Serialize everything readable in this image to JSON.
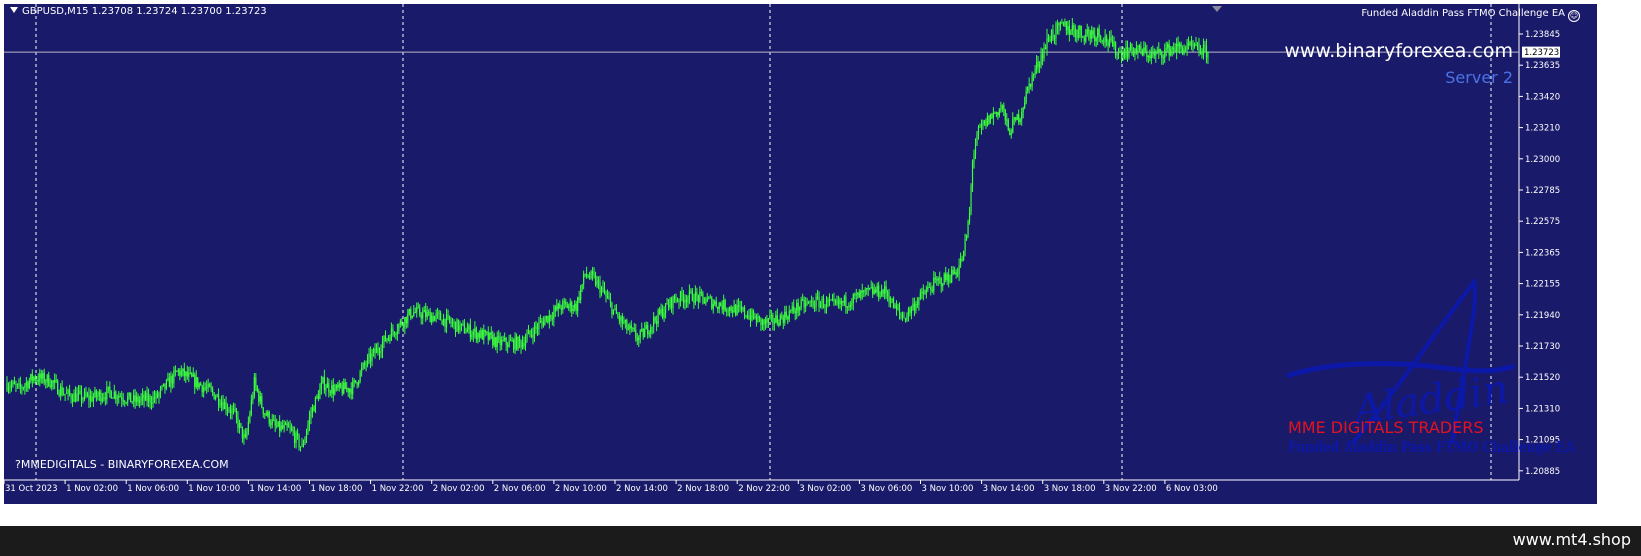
{
  "header": {
    "symbol_line": "GBPUSD,M15  1.23708 1.23724 1.23700 1.23723",
    "ea_title": "Funded Aladdin Pass FTMO Challenge EA",
    "ea_icon": "smiley-icon"
  },
  "overlay": {
    "website": "www.binaryforexea.com",
    "server": "Server 2",
    "copyright": "?MMEDIGITALS - BINARYFOREXEA.COM",
    "logo_script_text": "Aladdin",
    "logo_company": "MME DIGITALS TRADERS",
    "logo_product": "Funded Aladdin Pass FTMO Challenge EA"
  },
  "footer": {
    "site_label": "www.mt4.shop"
  },
  "colors": {
    "chart_background": "#1a1a6b",
    "candle": "#3cff3c",
    "axis_text": "#ffffff",
    "grid_separator": "#ffffff",
    "server_text": "#4a74e6",
    "logo_red": "#e0141e",
    "logo_blue": "#0c18a8"
  },
  "chart_data": {
    "type": "candlestick",
    "symbol": "GBPUSD",
    "timeframe": "M15",
    "ohlc_last": {
      "open": 1.23708,
      "high": 1.23724,
      "low": 1.237,
      "close": 1.23723
    },
    "current_price": "1.23723",
    "y_ticks": [
      "1.23845",
      "1.23635",
      "1.23420",
      "1.23210",
      "1.23000",
      "1.22785",
      "1.22575",
      "1.22365",
      "1.22155",
      "1.21940",
      "1.21730",
      "1.21520",
      "1.21310",
      "1.21095",
      "1.20885"
    ],
    "ylim": [
      1.2084,
      1.2403
    ],
    "x_ticks": [
      "31 Oct 2023",
      "1 Nov 02:00",
      "1 Nov 06:00",
      "1 Nov 10:00",
      "1 Nov 14:00",
      "1 Nov 18:00",
      "1 Nov 22:00",
      "2 Nov 02:00",
      "2 Nov 06:00",
      "2 Nov 10:00",
      "2 Nov 14:00",
      "2 Nov 18:00",
      "2 Nov 22:00",
      "3 Nov 02:00",
      "3 Nov 06:00",
      "3 Nov 10:00",
      "3 Nov 14:00",
      "3 Nov 18:00",
      "3 Nov 22:00",
      "6 Nov 03:00"
    ],
    "day_separators": [
      "1 Nov",
      "2 Nov",
      "3 Nov",
      "6 Nov"
    ],
    "close_path": [
      [
        0,
        1.2148
      ],
      [
        8,
        1.2144
      ],
      [
        18,
        1.2152
      ],
      [
        28,
        1.215
      ],
      [
        40,
        1.214
      ],
      [
        55,
        1.2138
      ],
      [
        70,
        1.2142
      ],
      [
        85,
        1.2136
      ],
      [
        100,
        1.2138
      ],
      [
        115,
        1.2156
      ],
      [
        128,
        1.2148
      ],
      [
        140,
        1.214
      ],
      [
        152,
        1.2128
      ],
      [
        160,
        1.2108
      ],
      [
        166,
        1.2148
      ],
      [
        172,
        1.213
      ],
      [
        180,
        1.2118
      ],
      [
        190,
        1.2116
      ],
      [
        198,
        1.2104
      ],
      [
        204,
        1.2128
      ],
      [
        212,
        1.2148
      ],
      [
        220,
        1.2143
      ],
      [
        232,
        1.2145
      ],
      [
        240,
        1.216
      ],
      [
        256,
        1.218
      ],
      [
        272,
        1.2196
      ],
      [
        290,
        1.2192
      ],
      [
        305,
        1.2185
      ],
      [
        320,
        1.218
      ],
      [
        330,
        1.2175
      ],
      [
        345,
        1.2175
      ],
      [
        360,
        1.219
      ],
      [
        372,
        1.22
      ],
      [
        382,
        1.22
      ],
      [
        388,
        1.2222
      ],
      [
        394,
        1.2218
      ],
      [
        400,
        1.221
      ],
      [
        408,
        1.2195
      ],
      [
        416,
        1.2185
      ],
      [
        424,
        1.2178
      ],
      [
        436,
        1.2192
      ],
      [
        448,
        1.2205
      ],
      [
        460,
        1.2207
      ],
      [
        472,
        1.2203
      ],
      [
        482,
        1.22
      ],
      [
        496,
        1.2195
      ],
      [
        508,
        1.2188
      ],
      [
        520,
        1.2192
      ],
      [
        532,
        1.22
      ],
      [
        544,
        1.2203
      ],
      [
        556,
        1.22
      ],
      [
        568,
        1.2205
      ],
      [
        580,
        1.221
      ],
      [
        590,
        1.221
      ],
      [
        596,
        1.2198
      ],
      [
        602,
        1.2192
      ],
      [
        612,
        1.2205
      ],
      [
        622,
        1.2215
      ],
      [
        632,
        1.222
      ],
      [
        638,
        1.2225
      ],
      [
        642,
        1.2235
      ],
      [
        646,
        1.2262
      ],
      [
        648,
        1.23
      ],
      [
        652,
        1.2318
      ],
      [
        660,
        1.2328
      ],
      [
        668,
        1.2335
      ],
      [
        672,
        1.2318
      ],
      [
        680,
        1.233
      ],
      [
        686,
        1.235
      ],
      [
        694,
        1.237
      ],
      [
        700,
        1.2383
      ],
      [
        710,
        1.2388
      ],
      [
        722,
        1.2384
      ],
      [
        734,
        1.2384
      ],
      [
        740,
        1.2378
      ],
      [
        746,
        1.2372
      ],
      [
        756,
        1.2374
      ],
      [
        770,
        1.237
      ],
      [
        782,
        1.2375
      ],
      [
        796,
        1.2375
      ],
      [
        806,
        1.2372
      ]
    ]
  }
}
